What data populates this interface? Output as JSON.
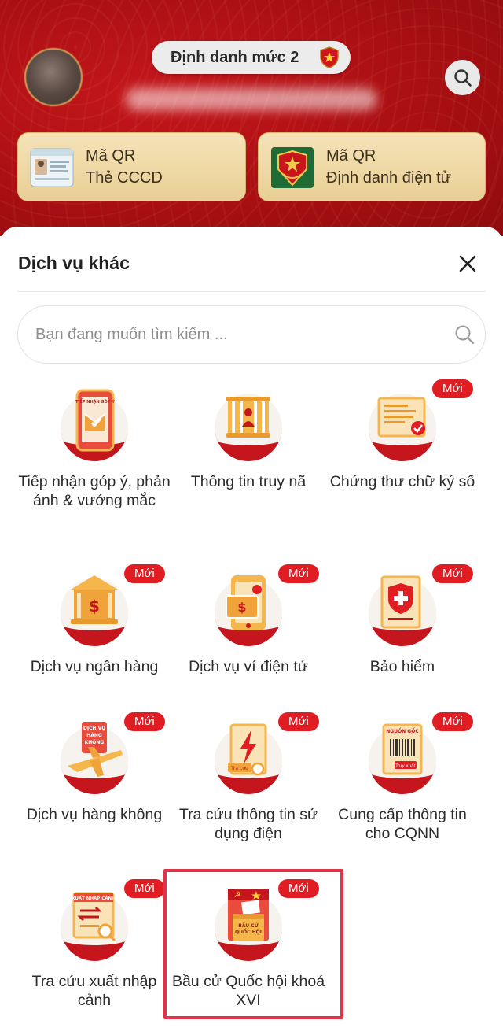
{
  "header": {
    "level_badge": "Định danh mức 2",
    "qr_cards": [
      {
        "line1": "Mã QR",
        "line2": "Thẻ CCCD",
        "icon": "id-card-icon"
      },
      {
        "line1": "Mã QR",
        "line2": "Định danh điện tử",
        "icon": "police-emblem-icon"
      }
    ]
  },
  "sheet": {
    "title": "Dịch vụ khác",
    "search_placeholder": "Bạn đang muốn tìm kiếm ...",
    "new_label": "Mới",
    "services": [
      {
        "label": "Tiếp nhận góp ý, phản ánh & vướng mắc",
        "icon": "feedback-phone-icon",
        "new": false
      },
      {
        "label": "Thông tin truy nã",
        "icon": "wanted-jail-icon",
        "new": false
      },
      {
        "label": "Chứng thư chữ ký số",
        "icon": "digital-certificate-icon",
        "new": true
      },
      {
        "label": "Dịch vụ ngân hàng",
        "icon": "bank-icon",
        "new": true
      },
      {
        "label": "Dịch vụ ví điện tử",
        "icon": "e-wallet-icon",
        "new": true
      },
      {
        "label": "Bảo hiểm",
        "icon": "insurance-shield-icon",
        "new": true
      },
      {
        "label": "Dịch vụ hàng không",
        "icon": "airplane-icon",
        "new": true
      },
      {
        "label": "Tra cứu thông tin sử dụng điện",
        "icon": "electricity-icon",
        "new": true
      },
      {
        "label": "Cung cấp thông tin cho CQNN",
        "icon": "barcode-document-icon",
        "new": true
      },
      {
        "label": "Tra cứu xuất nhập cảnh",
        "icon": "immigration-icon",
        "new": true
      },
      {
        "label": "Bầu cử Quốc hội khoá XVI",
        "icon": "ballot-box-icon",
        "new": true
      }
    ],
    "art_text": {
      "feedback": "TIẾP NHẬN GÓP Ý",
      "airline": [
        "DỊCH VỤ",
        "HÀNG",
        "KHÔNG"
      ],
      "electric": "Tra cứu",
      "origin": "NGUỒN GỐC",
      "trace": "Truy xuất",
      "immigration": "XUẤT NHẬP CẢNH",
      "ballot": [
        "BẦU CỬ",
        "QUỐC HỘI"
      ]
    }
  },
  "colors": {
    "brand_red": "#c4161c",
    "badge_red": "#e11d24",
    "gold": "#e9cf95",
    "highlight": "#e2334a"
  }
}
